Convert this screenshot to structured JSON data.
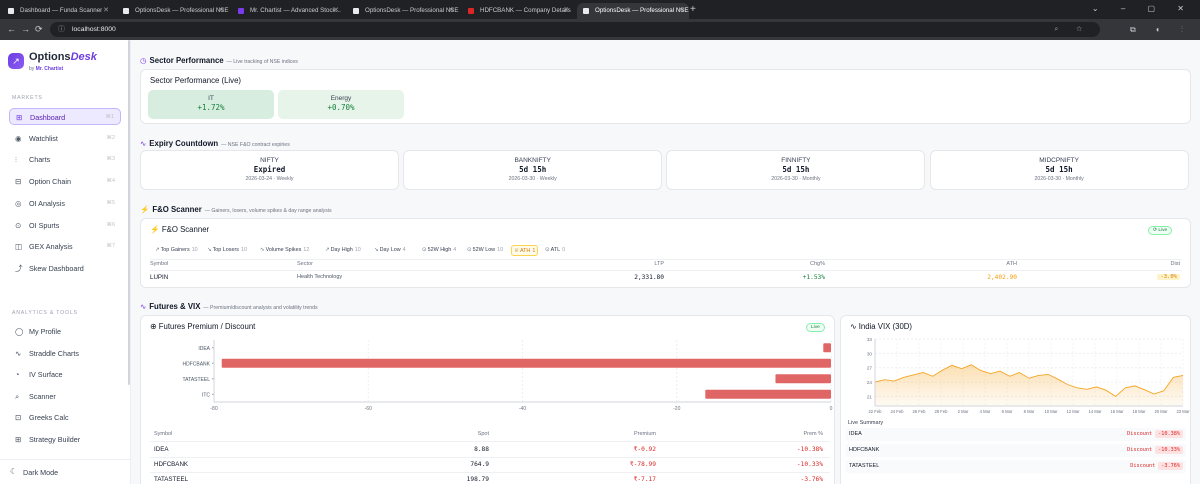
{
  "browser": {
    "tabs": [
      {
        "title": "Dashboard — Funda Scanner",
        "color": "#e8eaed"
      },
      {
        "title": "OptionsDesk — Professional NSE...",
        "color": "#e8eaed"
      },
      {
        "title": "Mr. Chartist — Advanced Stock...",
        "color": "#7c3aed"
      },
      {
        "title": "OptionsDesk — Professional NSE...",
        "color": "#e8eaed"
      },
      {
        "title": "HDFCBANK — Company Details",
        "color": "#dc2626"
      },
      {
        "title": "OptionsDesk — Professional NSE...",
        "color": "#e8eaed"
      }
    ],
    "url": "localhost:8000"
  },
  "sidebar": {
    "brand": "Options",
    "brand_accent": "Desk",
    "byline": "by",
    "byline_name": "Mr. Chartist",
    "markets_title": "MARKETS",
    "markets": [
      {
        "label": "Dashboard",
        "shortcut": "⌘1",
        "icon": "dashboard-icon"
      },
      {
        "label": "Watchlist",
        "shortcut": "⌘2",
        "icon": "eye-icon"
      },
      {
        "label": "Charts",
        "shortcut": "⌘3",
        "icon": "chart-icon"
      },
      {
        "label": "Option Chain",
        "shortcut": "⌘4",
        "icon": "chain-icon"
      },
      {
        "label": "OI Analysis",
        "shortcut": "⌘5",
        "icon": "oi-icon"
      },
      {
        "label": "OI Spurts",
        "shortcut": "⌘6",
        "icon": "spurt-icon"
      },
      {
        "label": "GEX Analysis",
        "shortcut": "⌘7",
        "icon": "gex-icon"
      },
      {
        "label": "Skew Dashboard",
        "shortcut": "",
        "icon": "skew-icon"
      }
    ],
    "tools_title": "ANALYTICS & TOOLS",
    "tools": [
      {
        "label": "My Profile",
        "icon": "profile-icon"
      },
      {
        "label": "Straddle Charts",
        "icon": "straddle-icon"
      },
      {
        "label": "IV Surface",
        "icon": "surface-icon"
      },
      {
        "label": "Scanner",
        "icon": "scanner-icon"
      },
      {
        "label": "Greeks Calc",
        "icon": "calc-icon"
      },
      {
        "label": "Strategy Builder",
        "icon": "builder-icon"
      }
    ],
    "dark_mode": "Dark Mode"
  },
  "sector": {
    "heading": "Sector Performance",
    "sub": "— Live tracking of NSE indices",
    "card_title": "Sector Performance (Live)",
    "tiles": [
      {
        "name": "IT",
        "change": "+1.72%",
        "bg": "#d7eddf"
      },
      {
        "name": "Energy",
        "change": "+0.70%",
        "bg": "#e7f4ea"
      }
    ]
  },
  "expiry": {
    "heading": "Expiry Countdown",
    "sub": "— NSE F&O contract expiries",
    "cards": [
      {
        "name": "NIFTY",
        "value": "Expired",
        "date": "2026-03-24 · Weekly"
      },
      {
        "name": "BANKNIFTY",
        "value": "5d 15h",
        "date": "2026-03-30 · Weekly"
      },
      {
        "name": "FINNIFTY",
        "value": "5d 15h",
        "date": "2026-03-30 · Monthly"
      },
      {
        "name": "MIDCPNIFTY",
        "value": "5d 15h",
        "date": "2026-03-30 · Monthly"
      }
    ]
  },
  "fo": {
    "heading": "F&O Scanner",
    "sub": "— Gainers, losers, volume spikes & day range analysis",
    "card_title": "F&O Scanner",
    "live": "⟳ Live",
    "chips": [
      {
        "label": "Top Gainers",
        "count": "10",
        "icon": "↗"
      },
      {
        "label": "Top Losers",
        "count": "10",
        "icon": "↘"
      },
      {
        "label": "Volume Spikes",
        "count": "12",
        "icon": "∿"
      },
      {
        "label": "Day High",
        "count": "10",
        "icon": "↗"
      },
      {
        "label": "Day Low",
        "count": "4",
        "icon": "↘"
      },
      {
        "label": "52W High",
        "count": "4",
        "icon": "⊙"
      },
      {
        "label": "52W Low",
        "count": "10",
        "icon": "⊙"
      },
      {
        "label": "ATH",
        "count": "1",
        "icon": "♕"
      },
      {
        "label": "ATL",
        "count": "0",
        "icon": "⊙"
      }
    ],
    "columns": [
      "Symbol",
      "Sector",
      "LTP",
      "Chg%",
      "ATH",
      "Dist"
    ],
    "rows": [
      {
        "symbol": "LUPIN",
        "sector": "Health Technology",
        "ltp": "2,331.80",
        "chg": "+1.53%",
        "ath": "2,402.90",
        "dist": "-3.0%"
      }
    ]
  },
  "futures": {
    "heading": "Futures & VIX",
    "sub": "— Premium/discount analysis and volatility trends",
    "premium_title": "Futures Premium / Discount",
    "live": "Live",
    "columns": [
      "Symbol",
      "Spot",
      "Premium",
      "Prem %"
    ],
    "rows": [
      {
        "symbol": "IDEA",
        "spot": "8.88",
        "premium": "₹-0.92",
        "pct": "-10.38%"
      },
      {
        "symbol": "HDFCBANK",
        "spot": "764.9",
        "premium": "₹-78.99",
        "pct": "-10.33%"
      },
      {
        "symbol": "TATASTEEL",
        "spot": "198.79",
        "premium": "₹-7.17",
        "pct": "-3.76%"
      }
    ],
    "vix_title": "India VIX (30D)",
    "live_summary": "Live Summary",
    "summary": [
      {
        "symbol": "IDEA",
        "label": "Discount",
        "pct": "-10.38%"
      },
      {
        "symbol": "HDFCBANK",
        "label": "Discount",
        "pct": "-10.33%"
      },
      {
        "symbol": "TATASTEEL",
        "label": "Discount",
        "pct": "-3.76%"
      }
    ]
  },
  "chart_data": [
    {
      "type": "bar",
      "orientation": "horizontal",
      "categories": [
        "IDEA",
        "HDFCBANK",
        "TATASTEEL",
        "ITC"
      ],
      "values": [
        -1,
        -79,
        -7.2,
        -16.3
      ],
      "xlim": [
        -80,
        0
      ],
      "xticks": [
        "-80",
        "-60",
        "-40",
        "-20",
        "0"
      ],
      "grid": true,
      "color": "#e06666"
    },
    {
      "type": "area",
      "x": [
        "22 Feb",
        "24 Feb",
        "26 Feb",
        "28 Feb",
        "2 Mar",
        "4 Mar",
        "6 Mar",
        "8 Mar",
        "10 Mar",
        "12 Mar",
        "14 Mar",
        "16 Mar",
        "18 Mar",
        "20 Mar",
        "23 Mar"
      ],
      "y": [
        24.0,
        24.5,
        24.2,
        25.0,
        25.5,
        26.0,
        25.2,
        26.5,
        27.5,
        26.8,
        27.6,
        26.4,
        25.8,
        26.3,
        25.2,
        26.0,
        24.8,
        25.4,
        25.6,
        24.6,
        23.5,
        22.8,
        22.5,
        23.0,
        22.3,
        21.0,
        22.8,
        23.2,
        22.4,
        21.5,
        22.2,
        25.0,
        25.4
      ],
      "ylim": [
        19,
        33
      ],
      "yticks": [
        "33",
        "30",
        "27",
        "24",
        "21"
      ],
      "grid": true,
      "color": "#f5a524"
    }
  ]
}
